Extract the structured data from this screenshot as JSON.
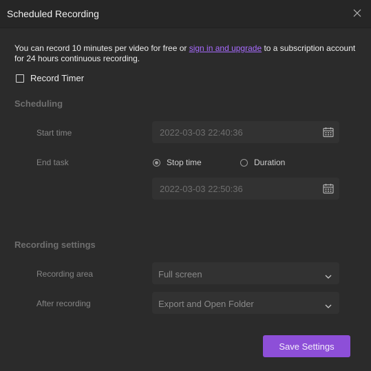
{
  "window": {
    "title": "Scheduled Recording",
    "close_icon": "close-icon"
  },
  "notice": {
    "text_before": "You can record 10 minutes per video for free or ",
    "link_text": "sign in and upgrade",
    "text_after": " to a subscription account for 24 hours continuous recording."
  },
  "record_timer": {
    "label": "Record Timer",
    "checked": false
  },
  "scheduling": {
    "section_title": "Scheduling",
    "start_time_label": "Start time",
    "start_time_value": "2022-03-03 22:40:36",
    "end_task_label": "End task",
    "stop_time_option": "Stop time",
    "duration_option": "Duration",
    "selected_option": "Stop time",
    "end_time_value": "2022-03-03 22:50:36",
    "calendar_icon": "calendar-icon"
  },
  "recording_settings": {
    "section_title": "Recording settings",
    "recording_area_label": "Recording area",
    "recording_area_value": "Full screen",
    "after_recording_label": "After recording",
    "after_recording_value": "Export and Open Folder",
    "chevron_icon": "chevron-down-icon"
  },
  "actions": {
    "save_label": "Save Settings"
  },
  "colors": {
    "background": "#2b2b2b",
    "title_bar": "#262626",
    "input_background": "#323232",
    "accent": "#8d4fd8",
    "link": "#a86bff"
  }
}
